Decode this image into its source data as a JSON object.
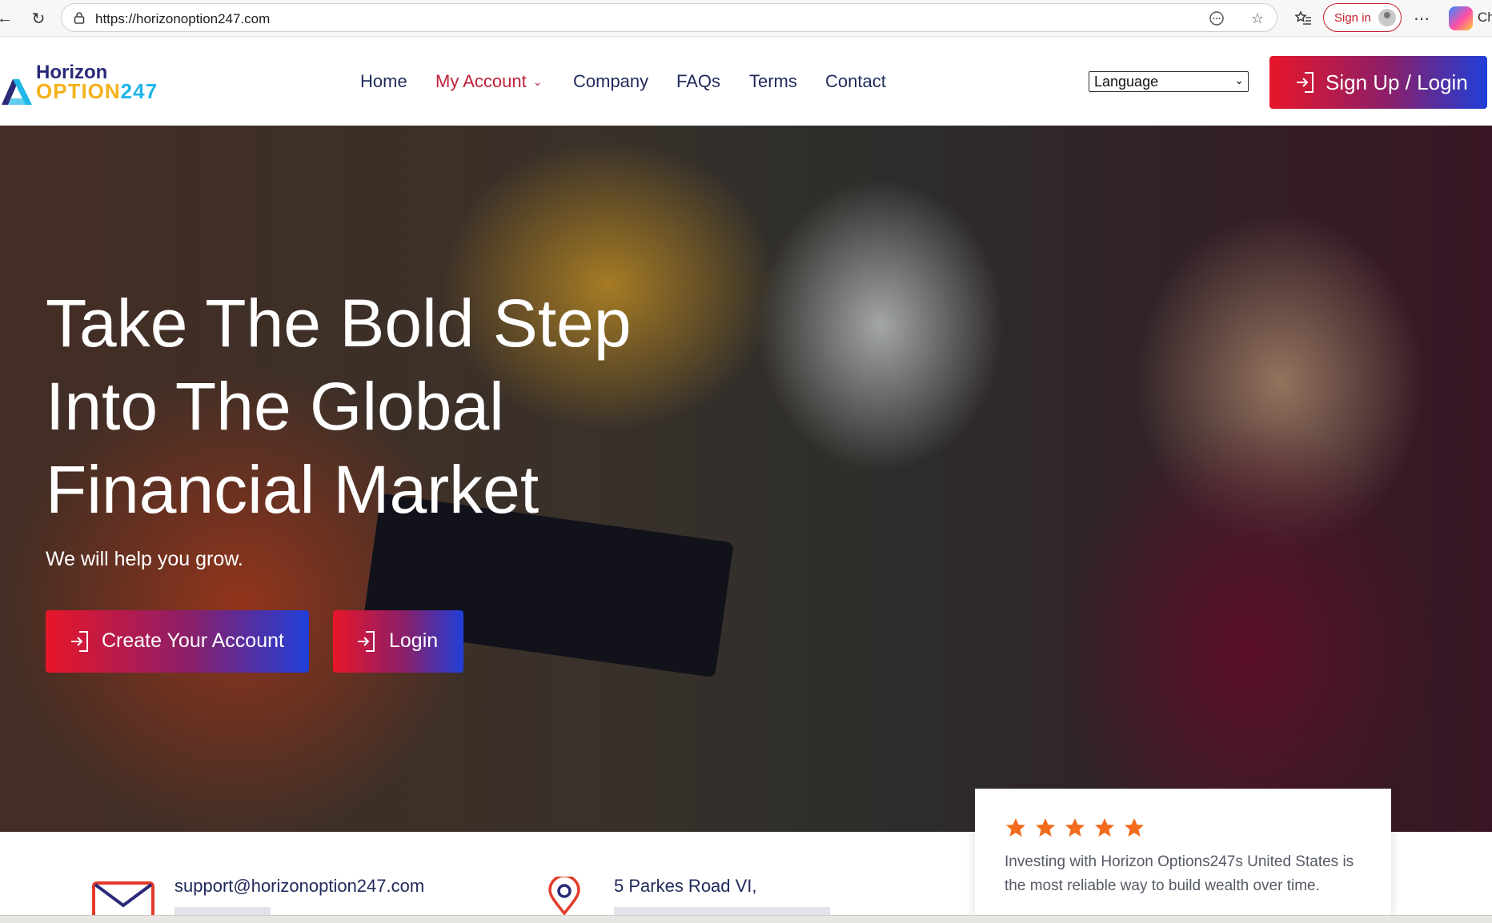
{
  "browser": {
    "url": "https://horizonoption247.com",
    "signin_label": "Sign in",
    "edge_partial_text": "Ch",
    "icons": [
      "back-icon",
      "reload-icon",
      "lock-icon",
      "reader-mode-icon",
      "favorite-star-icon",
      "favorites-icon",
      "profile-icon",
      "more-icon",
      "copilot-icon"
    ]
  },
  "header": {
    "logo": {
      "line1": "Horizon",
      "line2a": "OPTION",
      "line2b": "247"
    },
    "nav": {
      "home": "Home",
      "my_account": "My Account",
      "company": "Company",
      "faqs": "FAQs",
      "terms": "Terms",
      "contact": "Contact"
    },
    "language_select": "Language",
    "signup_login": "Sign Up / Login"
  },
  "hero": {
    "title_line1": "Take The Bold Step",
    "title_line2": "Into The Global",
    "title_line3": "Financial Market",
    "subtitle": "We will help you grow.",
    "create_account": "Create Your Account",
    "login": "Login"
  },
  "info": {
    "email": "support@horizonoption247.com",
    "address": "5 Parkes Road VI,"
  },
  "review": {
    "rating": 5,
    "text": "Investing with Horizon Options247s United States is the most reliable way to build wealth over time."
  },
  "colors": {
    "accent_red": "#e8162a",
    "accent_blue": "#1f3fd8",
    "nav_text": "#1f2a5a",
    "nav_active": "#c0213a",
    "star": "#f26b1d",
    "logo_yellow": "#f4b21b",
    "logo_cyan": "#1fb6e8"
  }
}
